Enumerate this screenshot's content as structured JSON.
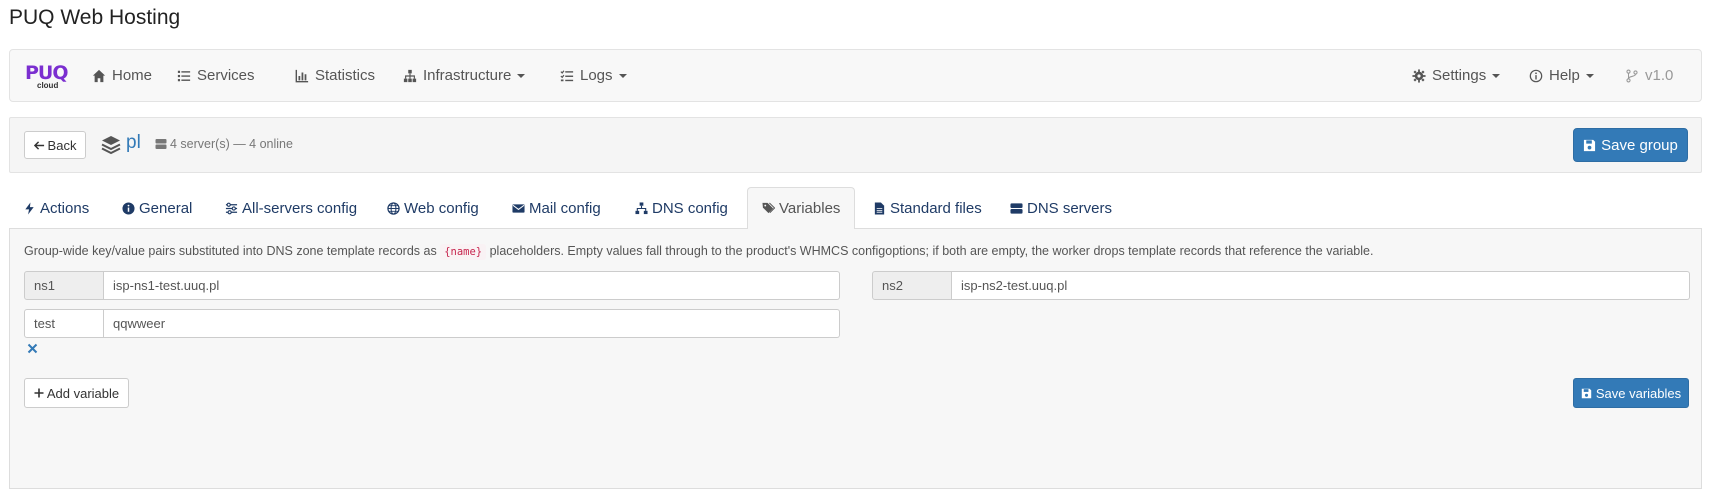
{
  "page": {
    "title": "PUQ Web Hosting"
  },
  "navbar": {
    "logo_text": "PUQ",
    "logo_subtext": "cloud",
    "items": [
      {
        "label": "Home",
        "icon": "home-icon"
      },
      {
        "label": "Services",
        "icon": "list-icon"
      },
      {
        "label": "Statistics",
        "icon": "chart-icon"
      },
      {
        "label": "Infrastructure",
        "icon": "sitemap-icon",
        "dropdown": true
      },
      {
        "label": "Logs",
        "icon": "tasks-icon",
        "dropdown": true
      }
    ],
    "right_items": [
      {
        "label": "Settings",
        "icon": "gear-icon",
        "dropdown": true
      },
      {
        "label": "Help",
        "icon": "info-icon",
        "dropdown": true
      },
      {
        "label": "v1.0",
        "icon": "branch-icon"
      }
    ]
  },
  "header": {
    "back_label": "Back",
    "group_name": "pl",
    "server_info": "4 server(s) — 4 online",
    "save_group_label": "Save group"
  },
  "tabs": [
    {
      "label": "Actions",
      "icon": "bolt-icon"
    },
    {
      "label": "General",
      "icon": "info-circle-icon"
    },
    {
      "label": "All-servers config",
      "icon": "sliders-icon"
    },
    {
      "label": "Web config",
      "icon": "globe-icon"
    },
    {
      "label": "Mail config",
      "icon": "envelope-icon"
    },
    {
      "label": "DNS config",
      "icon": "network-icon"
    },
    {
      "label": "Variables",
      "icon": "tags-icon",
      "active": true
    },
    {
      "label": "Standard files",
      "icon": "file-icon"
    },
    {
      "label": "DNS servers",
      "icon": "server-icon"
    }
  ],
  "variables": {
    "description_before": "Group-wide key/value pairs substituted into DNS zone template records as",
    "placeholder_code": "{name}",
    "description_after": "placeholders. Empty values fall through to the product's WHMCS configoptions; if both are empty, the worker drops template records that reference the variable.",
    "rows": [
      {
        "key": "ns1",
        "value": "isp-ns1-test.uuq.pl"
      },
      {
        "key": "ns2",
        "value": "isp-ns2-test.uuq.pl"
      },
      {
        "key": "test",
        "value": "qqwweer"
      }
    ],
    "add_label": "Add variable",
    "save_label": "Save variables"
  },
  "colors": {
    "primary": "#337ab7",
    "logo": "#7b2fd0",
    "tab_text": "#1f3b66"
  }
}
